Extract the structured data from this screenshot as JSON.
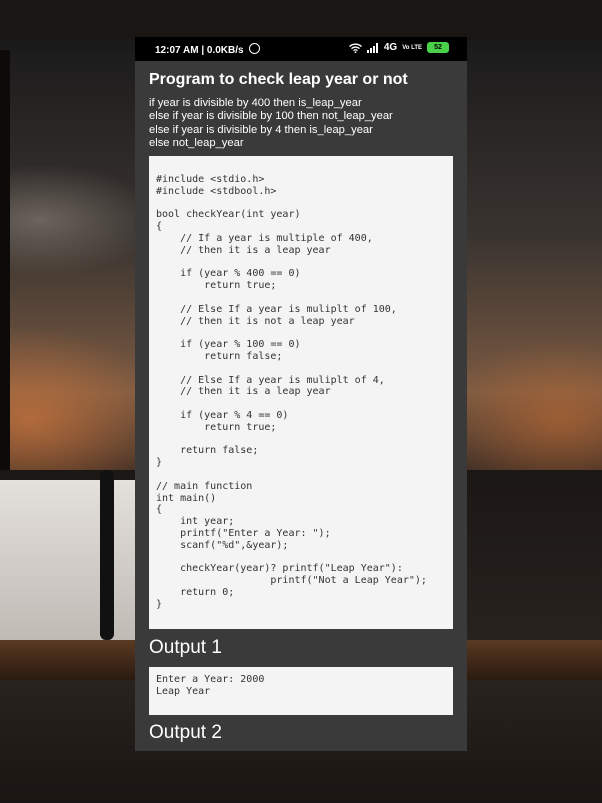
{
  "status_bar": {
    "time": "12:07 AM",
    "speed": "0.0KB/s",
    "network": "4G",
    "volte": "Vo LTE",
    "battery": "52"
  },
  "page": {
    "title": "Program to check leap year or not",
    "description_lines": [
      "if year is divisible by 400 then is_leap_year",
      "else if year is divisible by 100 then not_leap_year",
      "else if year is divisible by 4 then is_leap_year",
      "else not_leap_year"
    ],
    "code": "#include <stdio.h>\n#include <stdbool.h>\n\nbool checkYear(int year)\n{\n    // If a year is multiple of 400,\n    // then it is a leap year\n\n    if (year % 400 == 0)\n        return true;\n\n    // Else If a year is muliplt of 100,\n    // then it is not a leap year\n\n    if (year % 100 == 0)\n        return false;\n\n    // Else If a year is muliplt of 4,\n    // then it is a leap year\n\n    if (year % 4 == 0)\n        return true;\n\n    return false;\n}\n\n// main function\nint main()\n{\n    int year;\n    printf(\"Enter a Year: \");\n    scanf(\"%d\",&year);\n\n    checkYear(year)? printf(\"Leap Year\"):\n                   printf(\"Not a Leap Year\");\n    return 0;\n}",
    "output1_heading": "Output 1",
    "output1_text": "Enter a Year: 2000\nLeap Year",
    "output2_heading": "Output 2"
  },
  "colors": {
    "screen_bg": "#3a3a3a",
    "code_bg": "#f4f4f4",
    "battery": "#4ad14a"
  }
}
